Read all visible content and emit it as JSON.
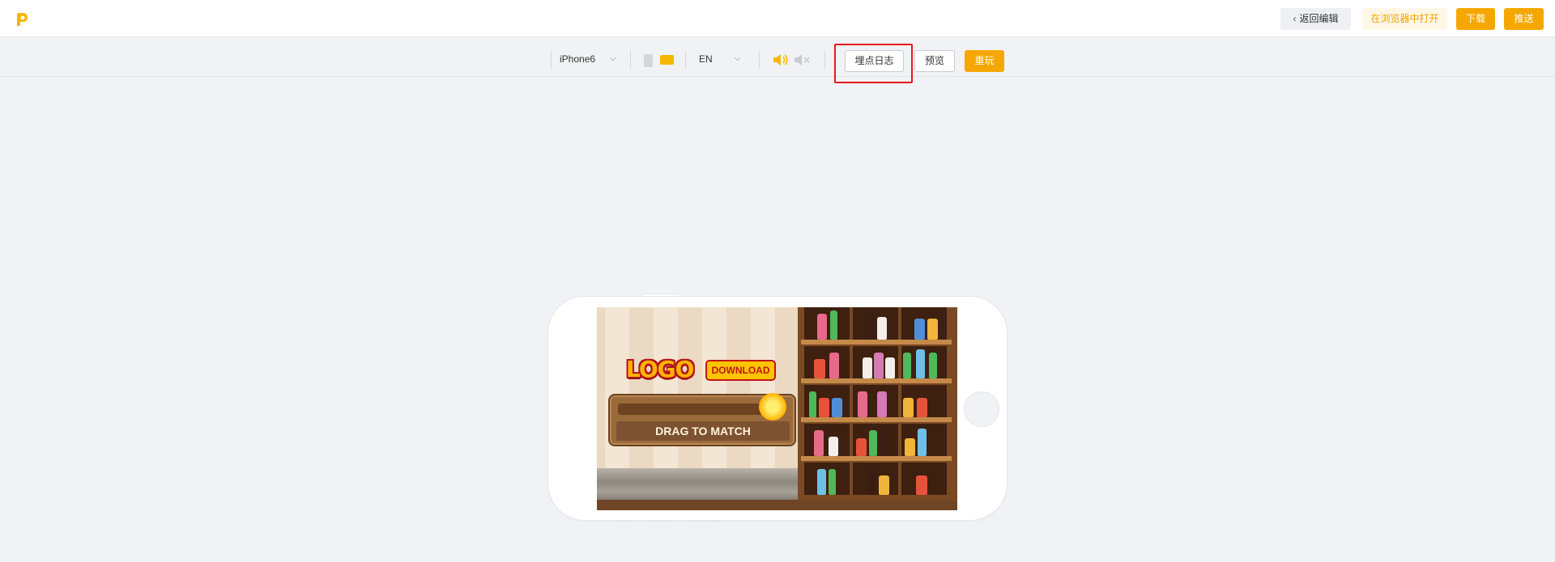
{
  "header": {
    "back_label": "返回编辑",
    "open_browser_label": "在浏览器中打开",
    "download_label": "下载",
    "push_label": "推送"
  },
  "toolbar": {
    "device": "iPhone6",
    "language": "EN",
    "log_label": "埋点日志",
    "preview_label": "预览",
    "replay_label": "重玩",
    "orientation": "landscape",
    "sound": "on"
  },
  "game": {
    "logo_text": "LOGO",
    "download_text": "DOWNLOAD",
    "drag_text": "DRAG TO MATCH"
  },
  "colors": {
    "accent": "#f5a700",
    "highlight": "#e8171b"
  }
}
